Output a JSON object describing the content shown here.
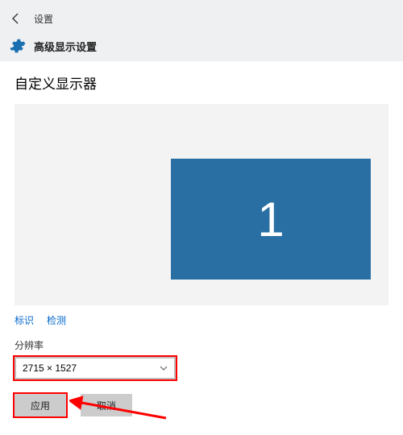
{
  "titlebar": {
    "settings_label": "设置"
  },
  "subheader": {
    "title": "高级显示设置"
  },
  "page": {
    "title": "自定义显示器"
  },
  "monitor": {
    "number": "1"
  },
  "links": {
    "identify": "标识",
    "detect": "检测"
  },
  "resolution": {
    "label": "分辨率",
    "value": "2715 × 1527"
  },
  "buttons": {
    "apply": "应用",
    "cancel": "取消"
  },
  "colors": {
    "monitor_tile": "#2a6fa3",
    "highlight": "#ff0000",
    "link": "#0066cc"
  }
}
